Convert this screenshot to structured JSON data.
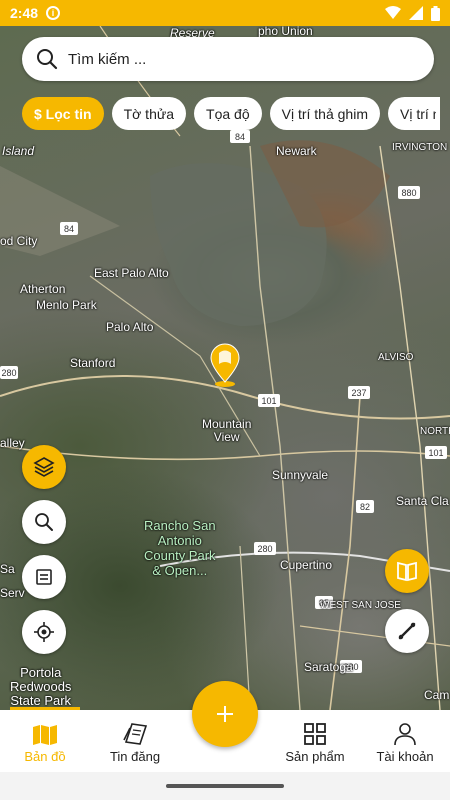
{
  "status_bar": {
    "time": "2:48",
    "info_icon": "info-icon",
    "icons": [
      "wifi-icon",
      "signal-icon",
      "battery-icon"
    ]
  },
  "search": {
    "placeholder": "Tìm kiếm ...",
    "icon": "search-icon"
  },
  "chips": [
    {
      "label": "$ Lọc tin",
      "active": true
    },
    {
      "label": "Tờ thửa",
      "active": false
    },
    {
      "label": "Tọa độ",
      "active": false
    },
    {
      "label": "Vị trí thả ghim",
      "active": false
    },
    {
      "label": "Vị trí ngay",
      "active": false
    }
  ],
  "map": {
    "labels": {
      "reserve": "Reserve",
      "pho_union": "pho Union",
      "island": "Island",
      "newark": "Newark",
      "irvington": "IRVINGTON",
      "od_city": "od City",
      "east_palo_alto": "East Palo Alto",
      "atherton": "Atherton",
      "menlo_park": "Menlo Park",
      "palo_alto": "Palo Alto",
      "stanford": "Stanford",
      "alviso": "ALVISO",
      "mountain_view": "Mountain\nView",
      "alley": "alley",
      "north": "NORTH",
      "sunnyvale": "Sunnyvale",
      "santa_clara": "Santa Cla",
      "rancho": "Rancho San\nAntonio\nCounty Park\n& Open...",
      "cupertino": "Cupertino",
      "west_san_jose": "WEST SAN JOSE",
      "portola": "Portola\nRedwoods\nState Park",
      "saratoga": "Saratoga",
      "sa": "Sa",
      "serv": "Serv",
      "cam": "Cam"
    },
    "shields": [
      "84",
      "880",
      "101",
      "237",
      "82",
      "101",
      "280",
      "85",
      "280",
      "880",
      "84"
    ]
  },
  "map_controls": {
    "layers": "layers-icon",
    "search": "search-icon",
    "list": "list-icon",
    "locate": "crosshair-icon",
    "book": "book-icon",
    "ruler": "ruler-icon"
  },
  "colors": {
    "accent": "#f6b800"
  },
  "bottom_nav": {
    "items": [
      {
        "label": "Bản đồ",
        "icon": "map-icon",
        "active": true
      },
      {
        "label": "Tin đăng",
        "icon": "news-icon",
        "active": false
      },
      {
        "label": "Sản phẩm",
        "icon": "grid-icon",
        "active": false
      },
      {
        "label": "Tài khoản",
        "icon": "user-icon",
        "active": false
      }
    ],
    "add_icon": "plus-icon"
  }
}
